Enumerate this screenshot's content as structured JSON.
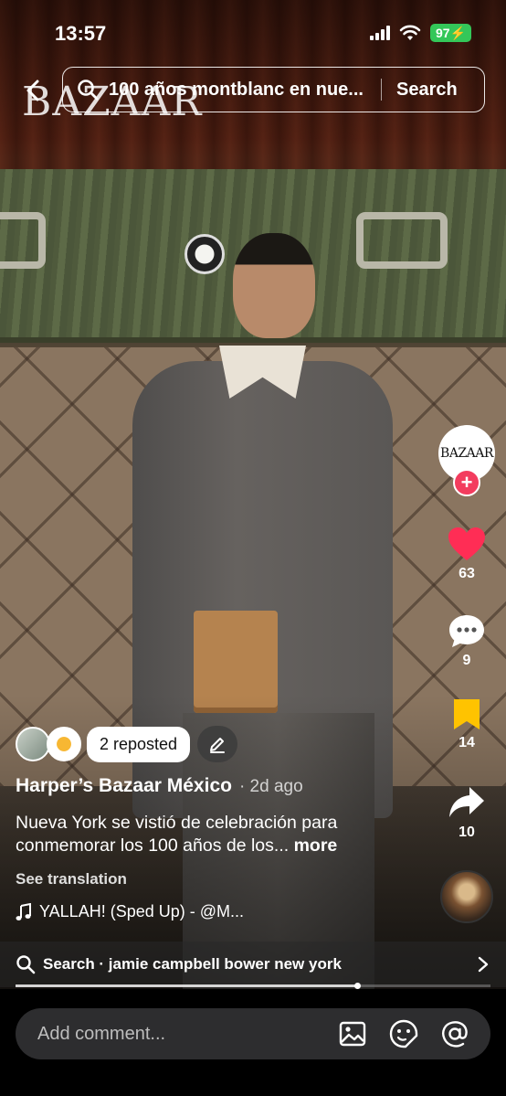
{
  "status_bar": {
    "time": "13:57",
    "battery": "97"
  },
  "search": {
    "query": "100 años montblanc en nue...",
    "button_label": "Search",
    "watermark": "BAZAAR"
  },
  "creator": {
    "avatar_text": "BAZAAR",
    "follow_symbol": "+"
  },
  "actions": {
    "likes": "63",
    "comments": "9",
    "saves": "14",
    "shares": "10",
    "like_color": "#ff2d55",
    "save_color": "#ffc300"
  },
  "post": {
    "reposted_label": "2 reposted",
    "author": "Harper’s Bazaar México",
    "time_ago": "· 2d ago",
    "caption": "Nueva York se vistió de celebración para conmemorar los 100 años de los...",
    "more_label": "more",
    "translate_label": "See translation",
    "music": "YALLAH! (Sped Up) - @M..."
  },
  "related_search": {
    "label": "Search · jamie campbell bower new york",
    "playback_progress": 0.72
  },
  "comment_input": {
    "placeholder": "Add comment..."
  }
}
